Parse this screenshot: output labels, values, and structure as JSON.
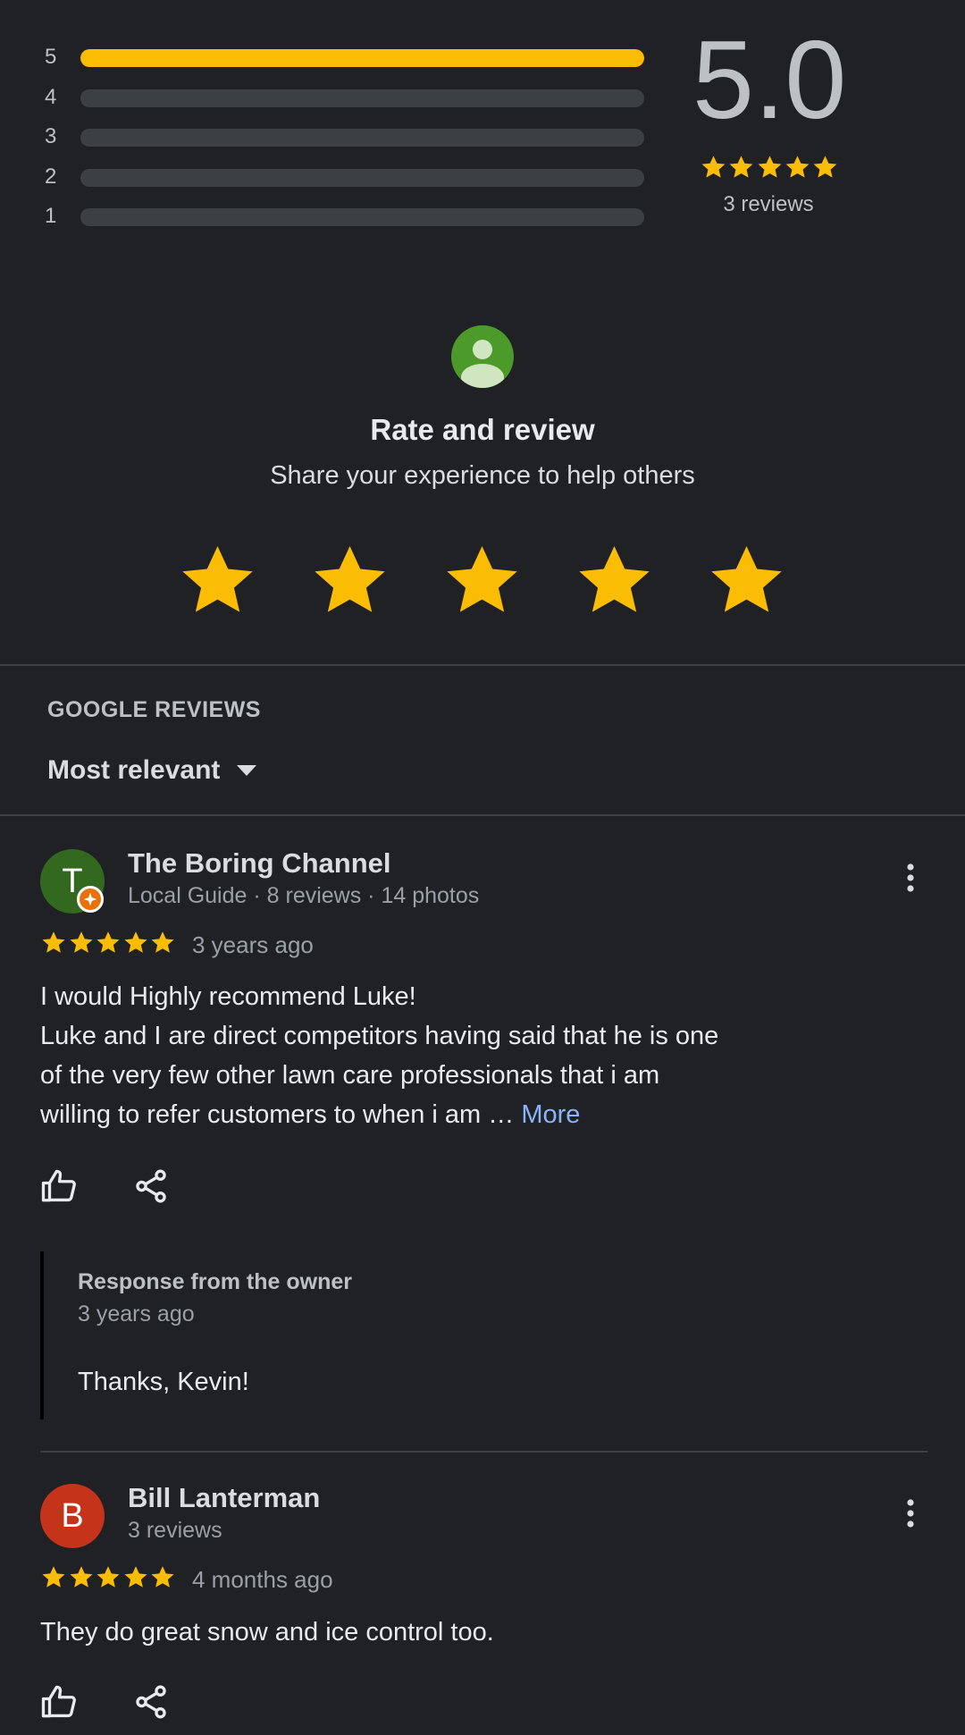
{
  "rating_summary": {
    "average": "5.0",
    "review_count_label": "3 reviews",
    "star_color": "#fbbc04",
    "distribution": [
      {
        "stars": "5",
        "fraction": 1.0
      },
      {
        "stars": "4",
        "fraction": 0.0
      },
      {
        "stars": "3",
        "fraction": 0.0
      },
      {
        "stars": "2",
        "fraction": 0.0
      },
      {
        "stars": "1",
        "fraction": 0.0
      }
    ]
  },
  "rate_and_review": {
    "avatar_icon": "person-icon",
    "title": "Rate and review",
    "subtitle": "Share your experience to help others",
    "star_count": 5
  },
  "reviews_section": {
    "label": "GOOGLE REVIEWS",
    "sort_label": "Most relevant"
  },
  "reviews": [
    {
      "avatar_letter": "T",
      "avatar_color": "#33691e",
      "local_guide": true,
      "name": "The Boring Channel",
      "meta": "Local Guide · 8 reviews · 14 photos",
      "rating": 5,
      "date": "3 years ago",
      "text_lines": [
        "I would Highly recommend Luke!",
        "Luke and I are direct competitors having said that he is one",
        "of the very few other lawn care professionals that i am",
        "willing to refer customers to when i am … "
      ],
      "more_label": "More",
      "owner_response": {
        "title": "Response from the owner",
        "date": "3 years ago",
        "text": "Thanks, Kevin!"
      }
    },
    {
      "avatar_letter": "B",
      "avatar_color": "#c5331a",
      "local_guide": false,
      "name": "Bill Lanterman",
      "meta": "3 reviews",
      "rating": 5,
      "date": "4 months ago",
      "text_lines": [
        "They do great snow and ice control too."
      ]
    }
  ]
}
